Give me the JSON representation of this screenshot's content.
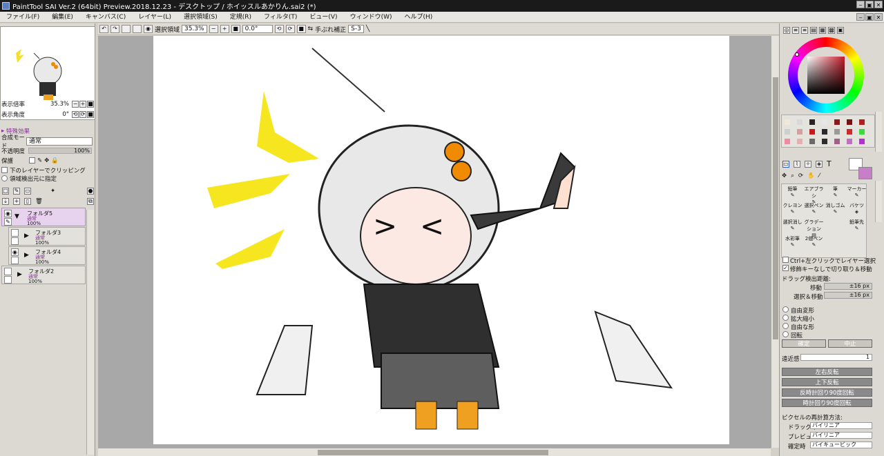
{
  "window": {
    "title": "PaintTool SAI Ver.2 (64bit) Preview.2018.12.23 - デスクトップ / ホイッスルあかりん.sai2 (*)",
    "min": "‒",
    "max": "▣",
    "close": "✕"
  },
  "menu": [
    "ファイル(F)",
    "編集(E)",
    "キャンバス(C)",
    "レイヤー(L)",
    "選択領域(S)",
    "定規(R)",
    "フィルタ(T)",
    "ビュー(V)",
    "ウィンドウ(W)",
    "ヘルプ(H)"
  ],
  "toolbar": {
    "select_area_label": "選択領域",
    "zoom": "35.3%",
    "angle": "0.0°",
    "stabilizer_label": "手ぶれ補正",
    "stabilizer_value": "S-3"
  },
  "navigator": {
    "zoom_label": "表示倍率",
    "zoom_value": "35.3%",
    "angle_label": "表示角度",
    "angle_value": "0°"
  },
  "layer_props": {
    "effect_label": "特殊効果",
    "blend_label": "合成モード",
    "blend_value": "通常",
    "opacity_label": "不透明度",
    "opacity_value": "100%",
    "opacity_fraction": 1.0,
    "protect_label": "保護",
    "clip_label": "下のレイヤーでクリッピング",
    "source_label": "領域検出元に指定"
  },
  "layers": [
    {
      "name": "フォルダ5",
      "mode": "通常",
      "opacity": "100%"
    },
    {
      "name": "フォルダ3",
      "mode": "通常",
      "opacity": "100%"
    },
    {
      "name": "フォルダ4",
      "mode": "通常",
      "opacity": "100%"
    },
    {
      "name": "フォルダ2",
      "mode": "通常",
      "opacity": "100%"
    }
  ],
  "tools": [
    {
      "label": "鉛筆"
    },
    {
      "label": "エアブラシ"
    },
    {
      "label": "筆"
    },
    {
      "label": "マーカー"
    },
    {
      "label": "クレヨン"
    },
    {
      "label": "選択ペン"
    },
    {
      "label": "消しゴム"
    },
    {
      "label": "バケツ"
    },
    {
      "label": "選択消し"
    },
    {
      "label": "グラデーション"
    },
    {
      "label": ""
    },
    {
      "label": "鉛筆先"
    },
    {
      "label": "水彩筆"
    },
    {
      "label": "2値ペン"
    }
  ],
  "options": {
    "ctrl_click_label": "Ctrl+左クリックでレイヤー選択",
    "modifier_label": "修飾キーなしで切り取り＆移動",
    "drag_label": "ドラッグ検出距離:",
    "move_label": "移動",
    "move_value": "±16 px",
    "select_move_label": "選択＆移動",
    "select_move_value": "±16 px",
    "transform": [
      "自由変形",
      "拡大縮小",
      "自由な形",
      "回転"
    ],
    "confirm": "確定",
    "cancel": "中止",
    "perspective_label": "遠近感",
    "perspective_value": "1",
    "flip_h": "左右反転",
    "flip_v": "上下反転",
    "rot_ccw": "反時計回り90度回転",
    "rot_cw": "時計回り90度回転",
    "resample_label": "ピクセルの再計算方法:",
    "drag_mode_label": "ドラッグ中",
    "drag_mode_value": "バイリニア",
    "preview_label": "プレビュー",
    "preview_value": "バイリニア",
    "confirm_mode_label": "確定時",
    "confirm_mode_value": "バイキュービック"
  },
  "colors": {
    "accent": "#b48bc6",
    "current": "#c77fc9",
    "palette": [
      "#f2e8d8",
      "#d9d9d9",
      "#262626",
      "#e6e6e6",
      "#8b1a1a",
      "#7a1010",
      "#b02020",
      "#cfcfcf",
      "#d4a0a0",
      "#c81c1c",
      "#2a2a2a",
      "#9a9a9a",
      "#cc2b2b",
      "#3ddc3d",
      "#f08aa0",
      "#e7b0b0",
      "#6a6a6a",
      "#2c2c2c",
      "#a0608a",
      "#c070c0",
      "#b030d0"
    ]
  }
}
